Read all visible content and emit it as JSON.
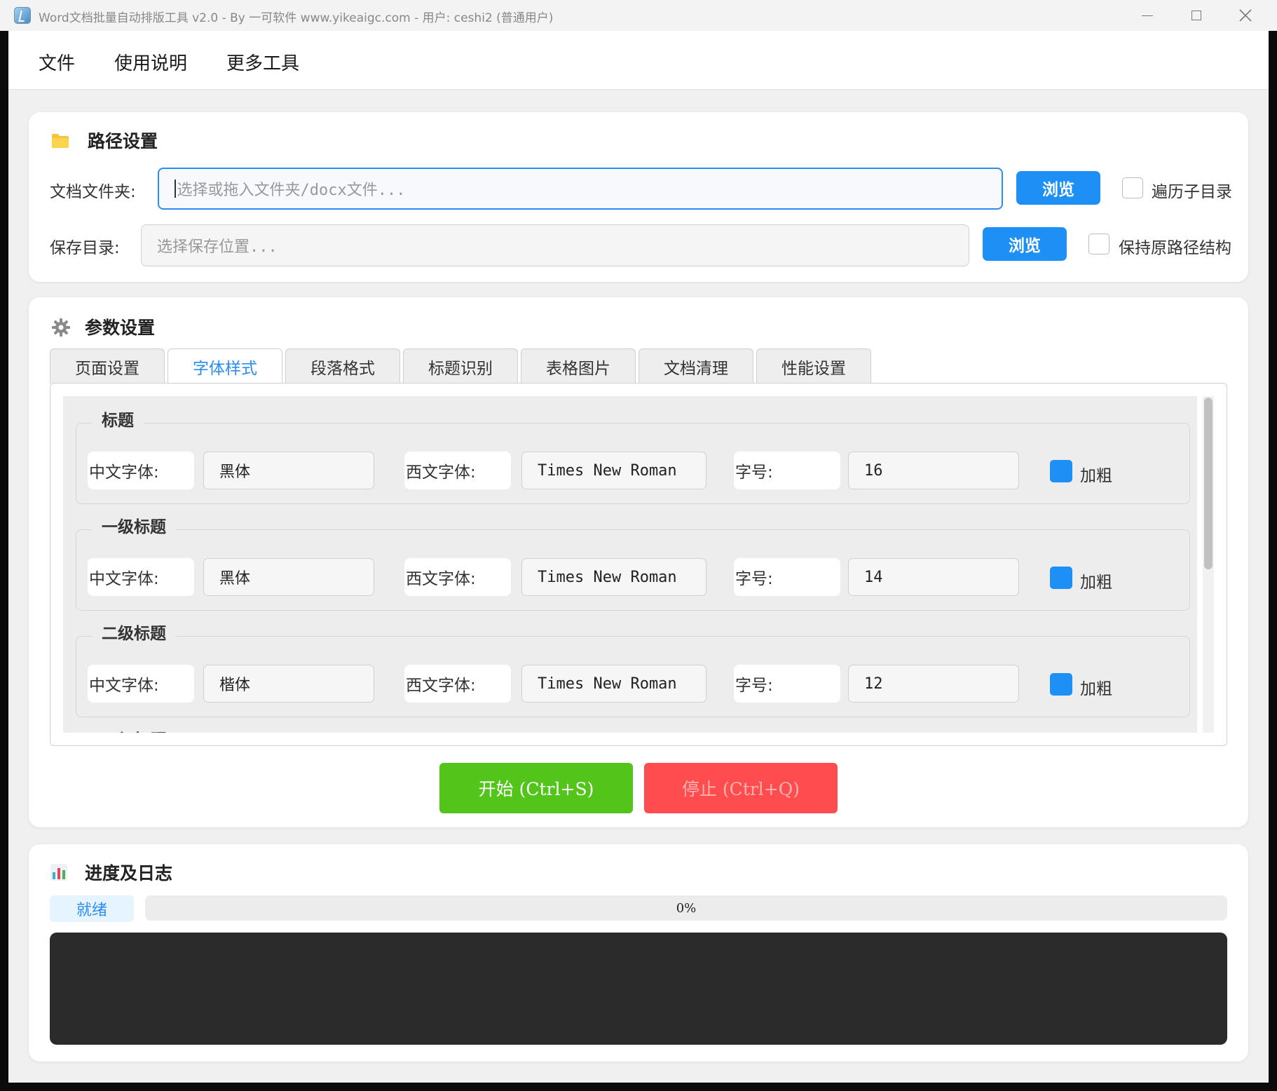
{
  "window": {
    "title": "Word文档批量自动排版工具 v2.0 - By 一可软件 www.yikeaigc.com - 用户: ceshi2 (普通用户)",
    "controls": {
      "minimize": "—",
      "maximize": "☐",
      "close": "✕"
    }
  },
  "menu": {
    "items": [
      "文件",
      "使用说明",
      "更多工具"
    ]
  },
  "path_settings": {
    "title": "路径设置",
    "icon": "folder-icon",
    "doc_folder": {
      "label": "文档文件夹:",
      "placeholder": "选择或拖入文件夹/docx文件...",
      "browse": "浏览",
      "checkbox_label": "遍历子目录",
      "checked": false
    },
    "save_dir": {
      "label": "保存目录:",
      "placeholder": "选择保存位置...",
      "browse": "浏览",
      "checkbox_label": "保持原路径结构",
      "checked": false
    }
  },
  "param_settings": {
    "title": "参数设置",
    "icon": "gear-icon",
    "tabs": [
      "页面设置",
      "字体样式",
      "段落格式",
      "标题识别",
      "表格图片",
      "文档清理",
      "性能设置"
    ],
    "active_tab": "字体样式",
    "groups": [
      {
        "title": "标题",
        "cn_font_label": "中文字体:",
        "cn_font": "黑体",
        "en_font_label": "西文字体:",
        "en_font": "Times New Roman",
        "size_label": "字号:",
        "size": "16",
        "bold_label": "加粗",
        "bold": true
      },
      {
        "title": "一级标题",
        "cn_font_label": "中文字体:",
        "cn_font": "黑体",
        "en_font_label": "西文字体:",
        "en_font": "Times New Roman",
        "size_label": "字号:",
        "size": "14",
        "bold_label": "加粗",
        "bold": true
      },
      {
        "title": "二级标题",
        "cn_font_label": "中文字体:",
        "cn_font": "楷体",
        "en_font_label": "西文字体:",
        "en_font": "Times New Roman",
        "size_label": "字号:",
        "size": "12",
        "bold_label": "加粗",
        "bold": true
      }
    ],
    "partial_group_title": "三级标题",
    "start_button": "开始 (Ctrl+S)",
    "stop_button": "停止 (Ctrl+Q)"
  },
  "progress": {
    "title": "进度及日志",
    "icon": "bar-chart-icon",
    "status": "就绪",
    "percent_text": "0%",
    "percent": 0
  },
  "colors": {
    "accent": "#1e8ff5",
    "start": "#52c41a",
    "stop": "#ff4d4f",
    "log_bg": "#2b2b2b"
  }
}
